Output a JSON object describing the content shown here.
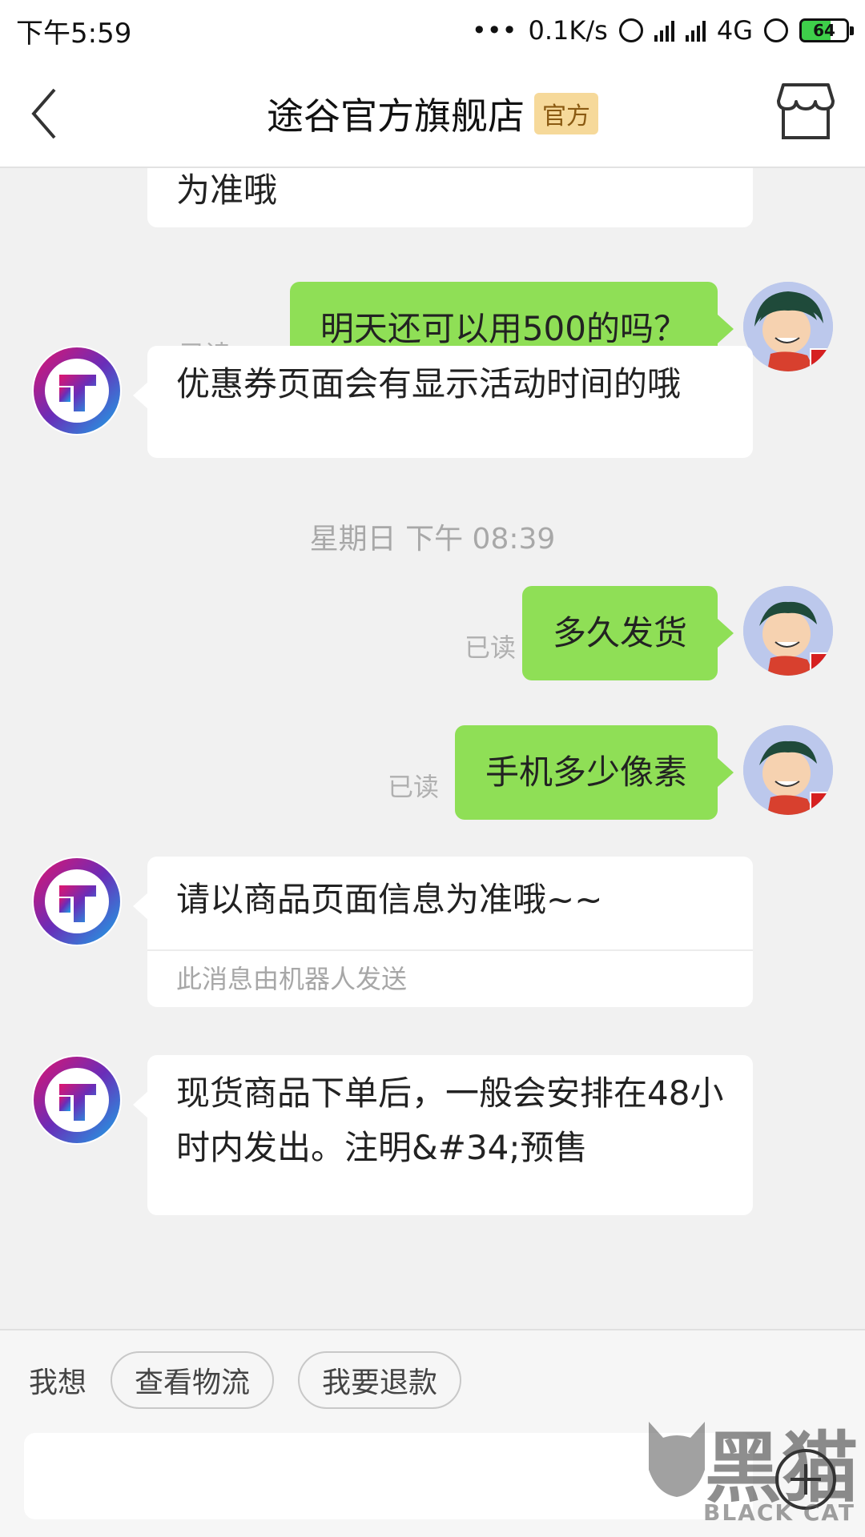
{
  "status_bar": {
    "time": "下午5:59",
    "dots": "•••",
    "speed": "0.1K/s",
    "network": "4G",
    "battery": "64"
  },
  "header": {
    "title": "途谷官方旗舰店",
    "badge": "官方"
  },
  "messages": [
    {
      "side": "left",
      "text": "为准哦"
    },
    {
      "side": "right",
      "text": "明天还可以用500的吗？",
      "status": "已读"
    },
    {
      "side": "left",
      "text": "优惠券页面会有显示活动时间的哦"
    },
    {
      "side": "time",
      "text": "星期日 下午 08:39"
    },
    {
      "side": "right",
      "text": "多久发货",
      "status": "已读"
    },
    {
      "side": "right",
      "text": "手机多少像素",
      "status": "已读"
    },
    {
      "side": "left",
      "text": "请以商品页面信息为准哦~~",
      "note": "此消息由机器人发送"
    },
    {
      "side": "left",
      "text": "现货商品下单后，一般会安排在48小时内发出。注明&#34;预售"
    }
  ],
  "quick_bar": {
    "label": "我想",
    "chips": [
      "查看物流",
      "我要退款"
    ]
  },
  "input": {
    "placeholder": ""
  },
  "watermark": {
    "main": "黑猫",
    "sub": "BLACK CAT"
  },
  "colors": {
    "accent_green": "#8fdf56",
    "badge_bg": "#f6d99a",
    "background": "#f1f1f1"
  }
}
